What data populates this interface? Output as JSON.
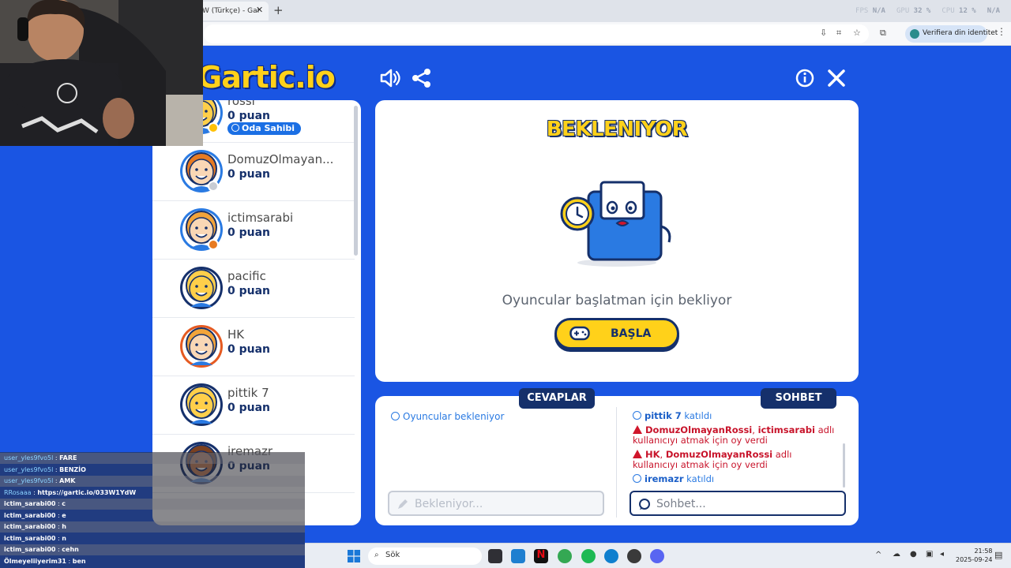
{
  "browser": {
    "tab_title": "W (Türkçe) - Gar",
    "address_verify_label": "Verifiera din identitet",
    "stats": [
      {
        "label": "FPS",
        "value": "N/A"
      },
      {
        "label": "GPU",
        "value": "32 %"
      },
      {
        "label": "CPU",
        "value": "12 %"
      },
      {
        "label": "",
        "value": "N/A"
      }
    ]
  },
  "game": {
    "logo_text": "Gartic.io",
    "players": [
      {
        "name": "rossi",
        "points": "0 puan",
        "badge": "Oda Sahibi",
        "dot": "#ffc107",
        "skin": "#ffcf4a",
        "hair": "#ffcf4a",
        "ring": "#2a7ae2"
      },
      {
        "name": "DomuzOlmayan...",
        "points": "0 puan",
        "dot": "#c8ccd3",
        "skin": "#f9d7b5",
        "hair": "#e77b22",
        "ring": "#2a7ae2"
      },
      {
        "name": "ictimsarabi",
        "points": "0 puan",
        "dot": "#e77b22",
        "skin": "#f9d7b5",
        "hair": "#f2a43a",
        "ring": "#2a7ae2"
      },
      {
        "name": "pacific",
        "points": "0 puan",
        "skin": "#ffcf4a",
        "hair": "#ffcf4a",
        "ring": "#15306b"
      },
      {
        "name": "HK",
        "points": "0 puan",
        "skin": "#f9d7b5",
        "hair": "#f2a43a",
        "ring": "#e55a21"
      },
      {
        "name": "pittik 7",
        "points": "0 puan",
        "skin": "#ffcf4a",
        "hair": "#ffcf4a",
        "ring": "#15306b"
      },
      {
        "name": "iremazr",
        "points": "0 puan",
        "skin": "#c9835a",
        "hair": "#7a4020",
        "ring": "#15306b"
      }
    ],
    "main": {
      "title": "BEKLENIYOR",
      "waiting_text": "Oyuncular başlatman için bekliyor",
      "start_button": "BAŞLA"
    },
    "answers": {
      "tab_label": "CEVAPLAR",
      "message": "Oyuncular bekleniyor",
      "input_placeholder": "Bekleniyor..."
    },
    "chat": {
      "tab_label": "SOHBET",
      "input_placeholder": "Sohbet...",
      "messages": [
        {
          "type": "info",
          "bold": "pittik 7",
          "text": " katıldı"
        },
        {
          "type": "warn",
          "bold": "DomuzOlmayanRossi",
          "bold2": "ictimsarabi",
          "text": " adlı kullanıcıyı atmak için oy verdi"
        },
        {
          "type": "warn",
          "bold": "HK",
          "bold2": "DomuzOlmayanRossi",
          "text": " adlı kullanıcıyı atmak için oy verdi"
        },
        {
          "type": "info",
          "bold": "iremazr",
          "text": " katıldı"
        }
      ]
    }
  },
  "stream_chat": [
    {
      "user": "user_yles9fvo5l",
      "msg": "FARE"
    },
    {
      "user": "user_yles9fvo5l",
      "msg": "BENZİO"
    },
    {
      "user": "user_yles9fvo5l",
      "msg": "AMK"
    },
    {
      "user": "RRosaaa",
      "msg": "https://gartic.io/033W1YdW"
    },
    {
      "user": "ictim_sarabi00",
      "msg": "c"
    },
    {
      "user": "ictim_sarabi00",
      "msg": "e"
    },
    {
      "user": "ictim_sarabi00",
      "msg": "h"
    },
    {
      "user": "ictim_sarabi00",
      "msg": "n"
    },
    {
      "user": "ictim_sarabi00",
      "msg": "cehn"
    },
    {
      "user": "Ölmeyeliiyerim31",
      "msg": "ben"
    }
  ],
  "taskbar": {
    "search_label": "Sök",
    "time": "21:58",
    "date": "2025-09-24"
  }
}
